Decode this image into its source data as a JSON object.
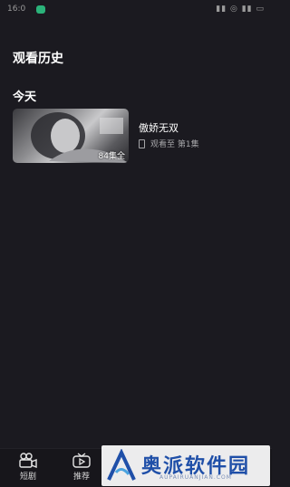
{
  "status_bar": {
    "time": "16:0",
    "icons_text": "▮▮ ◎ ▮▮ ▭"
  },
  "page": {
    "title": "观看历史"
  },
  "sections": [
    {
      "title": "今天",
      "items": [
        {
          "title": "傲娇无双",
          "progress_text": "观看至 第1集",
          "episode_count": "84集全"
        }
      ]
    }
  ],
  "tab_bar": {
    "tabs": [
      {
        "label": "短剧",
        "icon": "camera-icon"
      },
      {
        "label": "推荐",
        "icon": "tv-icon"
      }
    ]
  },
  "watermark": {
    "text": "奥派软件园",
    "url": "AUPAIRUANJIAN.COM",
    "accent_color": "#1f4fa8"
  }
}
